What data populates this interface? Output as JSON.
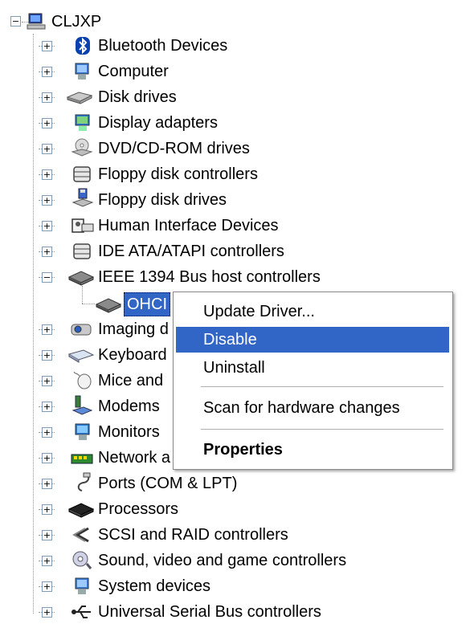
{
  "root": {
    "label": "CLJXP",
    "expander": "−",
    "icon": "computer-icon"
  },
  "items": [
    {
      "label": "Bluetooth Devices",
      "expander": "+",
      "icon": "bluetooth-icon"
    },
    {
      "label": "Computer",
      "expander": "+",
      "icon": "computer-icon"
    },
    {
      "label": "Disk drives",
      "expander": "+",
      "icon": "disk-drive-icon"
    },
    {
      "label": "Display adapters",
      "expander": "+",
      "icon": "display-adapter-icon"
    },
    {
      "label": "DVD/CD-ROM drives",
      "expander": "+",
      "icon": "cd-drive-icon"
    },
    {
      "label": "Floppy disk controllers",
      "expander": "+",
      "icon": "controller-icon"
    },
    {
      "label": "Floppy disk drives",
      "expander": "+",
      "icon": "floppy-drive-icon"
    },
    {
      "label": "Human Interface Devices",
      "expander": "+",
      "icon": "hid-icon"
    },
    {
      "label": "IDE ATA/ATAPI controllers",
      "expander": "+",
      "icon": "controller-icon"
    },
    {
      "label": "IEEE 1394 Bus host controllers",
      "expander": "−",
      "icon": "chip-icon"
    },
    {
      "label": "Imaging d",
      "expander": "+",
      "icon": "camera-icon"
    },
    {
      "label": "Keyboard",
      "expander": "+",
      "icon": "keyboard-icon"
    },
    {
      "label": "Mice and",
      "expander": "+",
      "icon": "mouse-icon"
    },
    {
      "label": "Modems",
      "expander": "+",
      "icon": "modem-icon"
    },
    {
      "label": "Monitors",
      "expander": "+",
      "icon": "monitor-icon"
    },
    {
      "label": "Network a",
      "expander": "+",
      "icon": "network-icon"
    },
    {
      "label": "Ports (COM & LPT)",
      "expander": "+",
      "icon": "port-icon"
    },
    {
      "label": "Processors",
      "expander": "+",
      "icon": "processor-icon"
    },
    {
      "label": "SCSI and RAID controllers",
      "expander": "+",
      "icon": "scsi-icon"
    },
    {
      "label": "Sound, video and game controllers",
      "expander": "+",
      "icon": "sound-icon"
    },
    {
      "label": "System devices",
      "expander": "+",
      "icon": "system-icon"
    },
    {
      "label": "Universal Serial Bus controllers",
      "expander": "+",
      "icon": "usb-icon"
    }
  ],
  "child": {
    "label": "OHCI",
    "icon": "chip-icon"
  },
  "context_menu": {
    "update_driver": "Update Driver...",
    "disable": "Disable",
    "uninstall": "Uninstall",
    "scan": "Scan for hardware changes",
    "properties": "Properties"
  }
}
